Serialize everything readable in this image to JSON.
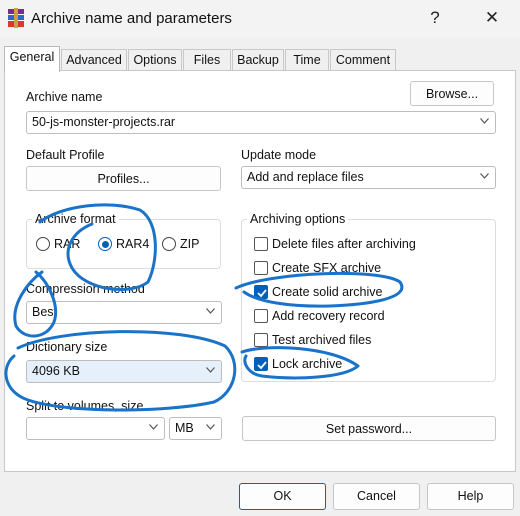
{
  "window": {
    "title": "Archive name and parameters",
    "help_glyph": "?",
    "close_glyph": "✕",
    "icon": "winrar-app-icon"
  },
  "tabs": [
    {
      "label": "General",
      "active": true
    },
    {
      "label": "Advanced"
    },
    {
      "label": "Options"
    },
    {
      "label": "Files"
    },
    {
      "label": "Backup"
    },
    {
      "label": "Time"
    },
    {
      "label": "Comment"
    }
  ],
  "archive": {
    "name_label": "Archive name",
    "name_value": "50-js-monster-projects.rar",
    "browse_label": "Browse..."
  },
  "profile": {
    "label": "Default Profile",
    "button": "Profiles..."
  },
  "update": {
    "label": "Update mode",
    "value": "Add and replace files"
  },
  "format": {
    "title": "Archive format",
    "options": [
      {
        "label": "RAR",
        "checked": false
      },
      {
        "label": "RAR4",
        "checked": true
      },
      {
        "label": "ZIP",
        "checked": false
      }
    ]
  },
  "compression": {
    "label": "Compression method",
    "value": "Best"
  },
  "dictionary": {
    "label": "Dictionary size",
    "value": "4096 KB"
  },
  "split": {
    "label": "Split to volumes, size",
    "value": "",
    "unit": "MB"
  },
  "archiving_options": {
    "title": "Archiving options",
    "items": [
      {
        "label": "Delete files after archiving",
        "checked": false
      },
      {
        "label": "Create SFX archive",
        "checked": false
      },
      {
        "label": "Create solid archive",
        "checked": true
      },
      {
        "label": "Add recovery record",
        "checked": false
      },
      {
        "label": "Test archived files",
        "checked": false
      },
      {
        "label": "Lock archive",
        "checked": true
      }
    ]
  },
  "password_button": "Set password...",
  "footer": {
    "ok": "OK",
    "cancel": "Cancel",
    "help": "Help"
  },
  "colors": {
    "accent": "#005fb8",
    "annotation": "#1a73c8"
  }
}
